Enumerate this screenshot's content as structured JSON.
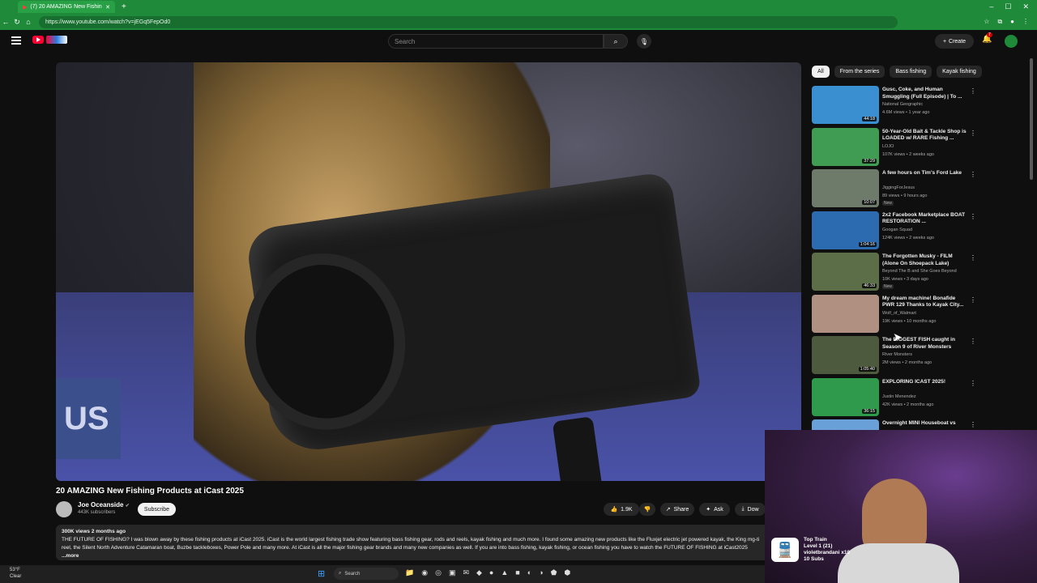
{
  "browser": {
    "tab_title": "(7) 20 AMAZING New Fishin",
    "url": "https://www.youtube.com/watch?v=jEGq5FepOd0"
  },
  "header": {
    "search_placeholder": "Search",
    "create_label": "Create",
    "notification_count": "7"
  },
  "video": {
    "title": "20 AMAZING New Fishing Products at iCast 2025",
    "channel": "Joe Oceanside",
    "subscribers": "443K subscribers",
    "subscribe_label": "Subscribe",
    "likes": "1.9K",
    "share_label": "Share",
    "ask_label": "Ask",
    "download_label": "Dow",
    "meta": "300K views  2 months ago",
    "description": "THE FUTURE OF FISHING? I was blown away by these fishing products at iCast 2025. iCast is the world largest fishing trade show featuring bass fishing gear, rods and reels, kayak fishing and much more. I found some amazing new products like the Fluxjet electric jet powered kayak, the King mg-ti reel, the Silent North Adventure Catamaran boat, Buzbe tackleboxes, Power Pole  and many more. At iCast is all the major fishing gear brands and many new companies as well. If you are into bass fishing, kayak fishing, or ocean fishing you have to watch the FUTURE OF FISHING at iCast2025",
    "more_label": "...more"
  },
  "chips": [
    "All",
    "From the series",
    "Bass fishing",
    "Kayak fishing"
  ],
  "recommendations": [
    {
      "title": "Gusc, Coke, and Human Smuggling (Full Episode) | To ...",
      "channel": "National Geographic",
      "stats": "4.6M views • 1 year ago",
      "duration": "44:18",
      "badge": "",
      "thumb": "#3a8fd0"
    },
    {
      "title": "50-Year-Old Bait & Tackle Shop is LOADED w/ RARE Fishing ...",
      "channel": "LOJO",
      "stats": "107K views • 2 weeks ago",
      "duration": "37:29",
      "badge": "",
      "thumb": "#3f9c52"
    },
    {
      "title": "A few hours on Tim's Ford Lake",
      "channel": "JiggingForJesus",
      "stats": "89 views • 9 hours ago",
      "duration": "10:07",
      "badge": "New",
      "thumb": "#6e7a6a"
    },
    {
      "title": "2x2 Facebook Marketplace BOAT RESTORATION ...",
      "channel": "Googan Squad",
      "stats": "124K views • 2 weeks ago",
      "duration": "1:04:16",
      "badge": "",
      "thumb": "#2d6bb0"
    },
    {
      "title": "The Forgotten Musky - FILM (Alone On Shoepack Lake)",
      "channel": "Beyond The B and She Goes Beyond",
      "stats": "10K views • 3 days ago",
      "duration": "46:33",
      "badge": "New",
      "thumb": "#5c6e48"
    },
    {
      "title": "My dream machine! Bonafide PWR 129 Thanks to Kayak City...",
      "channel": "Wolf_of_Walmart",
      "stats": "19K views • 10 months ago",
      "duration": "",
      "badge": "",
      "thumb": "#b09080"
    },
    {
      "title": "The BIGGEST FISH caught in Season 9 of River Monsters",
      "channel": "River Monsters",
      "stats": "2M views • 2 months ago",
      "duration": "1:05:40",
      "badge": "",
      "thumb": "#4e5a3e"
    },
    {
      "title": "EXPLORING ICAST 2025!",
      "channel": "Justin Menendez",
      "stats": "42K views • 2 months ago",
      "duration": "36:15",
      "badge": "",
      "thumb": "#2f9a4c"
    },
    {
      "title": "Overnight MINI Houseboat vs",
      "channel": "",
      "stats": "",
      "duration": "",
      "badge": "",
      "thumb": "#6aa0d8"
    }
  ],
  "webcam_overlay": {
    "line1": "Top Train",
    "line2": "Level 1  (21)",
    "line3": "violetbrandani x10",
    "line4": "10 Subs"
  },
  "taskbar": {
    "weather_temp": "53°F",
    "weather_desc": "Clear",
    "search_label": "Search"
  }
}
